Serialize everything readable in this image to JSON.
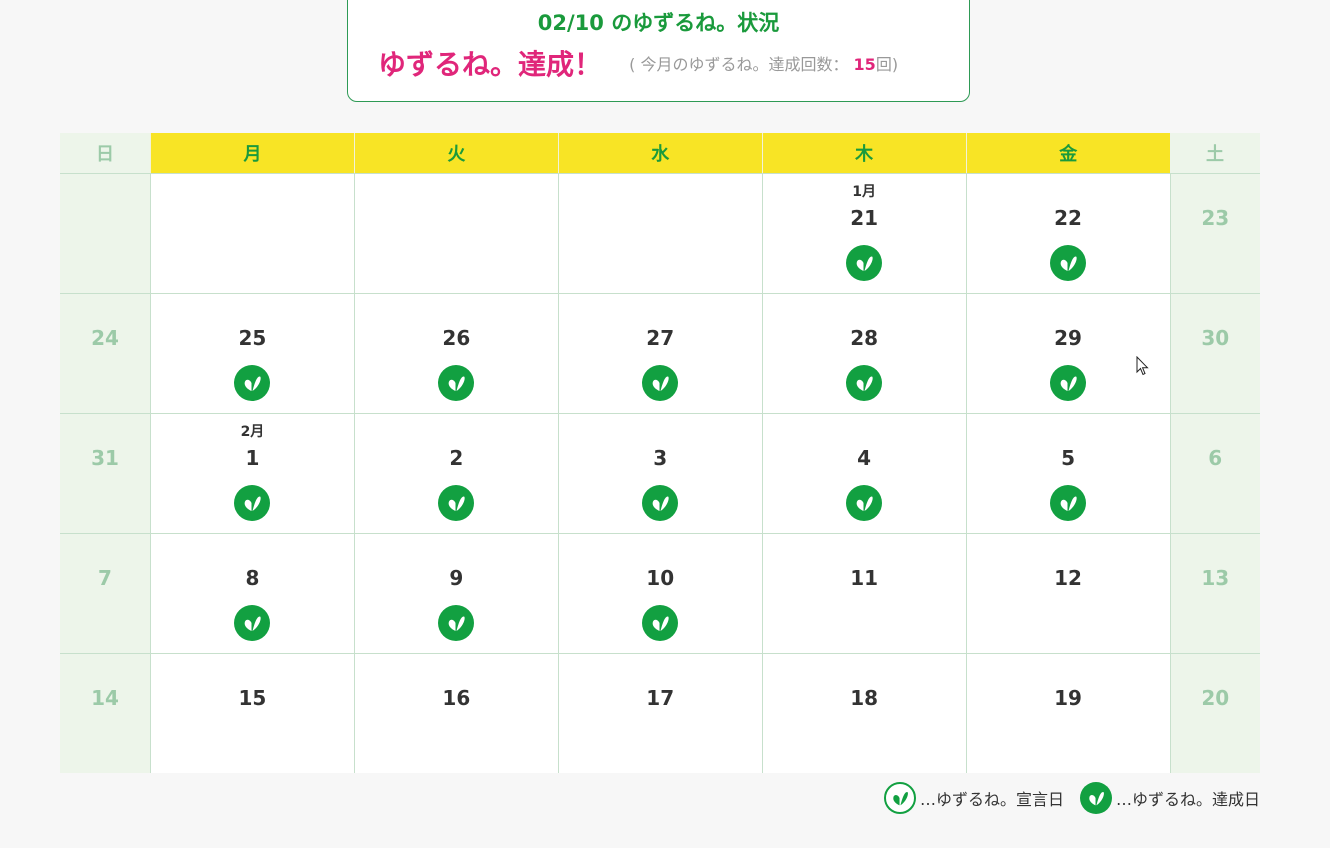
{
  "status": {
    "title": "02/10 のゆずるね。状況",
    "achieved_label": "ゆずるね。達成！",
    "count_prefix": "( 今月のゆずるね。達成回数：",
    "count_value": "15",
    "count_suffix": "回)"
  },
  "weekdays": [
    "日",
    "月",
    "火",
    "水",
    "木",
    "金",
    "土"
  ],
  "weeks": [
    [
      {
        "day": "",
        "month": "",
        "achieved": false
      },
      {
        "day": "",
        "month": "",
        "achieved": false
      },
      {
        "day": "",
        "month": "",
        "achieved": false
      },
      {
        "day": "",
        "month": "",
        "achieved": false
      },
      {
        "day": "21",
        "month": "1月",
        "achieved": true
      },
      {
        "day": "22",
        "month": "",
        "achieved": true
      },
      {
        "day": "23",
        "month": "",
        "achieved": false
      }
    ],
    [
      {
        "day": "24",
        "month": "",
        "achieved": false
      },
      {
        "day": "25",
        "month": "",
        "achieved": true
      },
      {
        "day": "26",
        "month": "",
        "achieved": true
      },
      {
        "day": "27",
        "month": "",
        "achieved": true
      },
      {
        "day": "28",
        "month": "",
        "achieved": true
      },
      {
        "day": "29",
        "month": "",
        "achieved": true
      },
      {
        "day": "30",
        "month": "",
        "achieved": false
      }
    ],
    [
      {
        "day": "31",
        "month": "",
        "achieved": false
      },
      {
        "day": "1",
        "month": "2月",
        "achieved": true
      },
      {
        "day": "2",
        "month": "",
        "achieved": true
      },
      {
        "day": "3",
        "month": "",
        "achieved": true
      },
      {
        "day": "4",
        "month": "",
        "achieved": true
      },
      {
        "day": "5",
        "month": "",
        "achieved": true
      },
      {
        "day": "6",
        "month": "",
        "achieved": false
      }
    ],
    [
      {
        "day": "7",
        "month": "",
        "achieved": false
      },
      {
        "day": "8",
        "month": "",
        "achieved": true
      },
      {
        "day": "9",
        "month": "",
        "achieved": true
      },
      {
        "day": "10",
        "month": "",
        "achieved": true
      },
      {
        "day": "11",
        "month": "",
        "achieved": false
      },
      {
        "day": "12",
        "month": "",
        "achieved": false
      },
      {
        "day": "13",
        "month": "",
        "achieved": false
      }
    ],
    [
      {
        "day": "14",
        "month": "",
        "achieved": false
      },
      {
        "day": "15",
        "month": "",
        "achieved": false
      },
      {
        "day": "16",
        "month": "",
        "achieved": false
      },
      {
        "day": "17",
        "month": "",
        "achieved": false
      },
      {
        "day": "18",
        "month": "",
        "achieved": false
      },
      {
        "day": "19",
        "month": "",
        "achieved": false
      },
      {
        "day": "20",
        "month": "",
        "achieved": false
      }
    ]
  ],
  "legend": {
    "declared": "…ゆずるね。宣言日",
    "achieved": "…ゆずるね。達成日"
  },
  "colors": {
    "accent_green": "#12a041",
    "header_yellow": "#f8e425",
    "achieved_pink": "#e0267a",
    "weekend_bg": "#edf5ea"
  },
  "icons": {
    "badge": "leaf-heart-icon",
    "cursor": "mouse-cursor-icon"
  }
}
